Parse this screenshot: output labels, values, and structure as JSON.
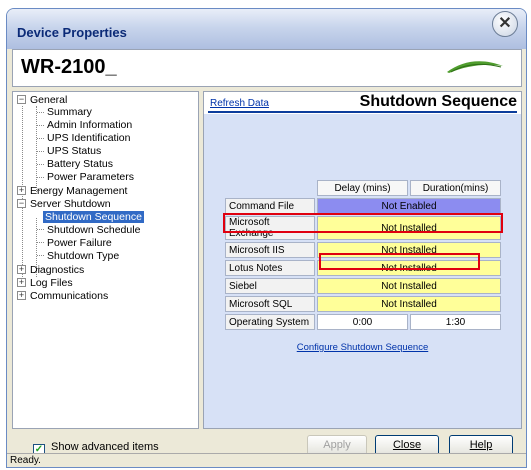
{
  "window": {
    "title": "Device Properties",
    "close_glyph": "✕"
  },
  "header": {
    "model": "WR-2100_"
  },
  "tree": {
    "general": "General",
    "summary": "Summary",
    "admin_information": "Admin Information",
    "ups_identification": "UPS Identification",
    "ups_status": "UPS Status",
    "battery_status": "Battery Status",
    "power_parameters": "Power Parameters",
    "energy_management": "Energy Management",
    "server_shutdown": "Server Shutdown",
    "shutdown_sequence": "Shutdown Sequence",
    "shutdown_schedule": "Shutdown Schedule",
    "power_failure": "Power Failure",
    "shutdown_type": "Shutdown Type",
    "diagnostics": "Diagnostics",
    "log_files": "Log Files",
    "communications": "Communications"
  },
  "main": {
    "refresh_label": "Refresh Data",
    "section_title": "Shutdown Sequence",
    "configure_link": "Configure Shutdown Sequence",
    "columns": {
      "delay": "Delay (mins)",
      "duration": "Duration(mins)"
    },
    "rows": [
      {
        "label": "Command File",
        "value": "Not Enabled"
      },
      {
        "label": "Microsoft Exchange",
        "value": "Not Installed"
      },
      {
        "label": "Microsoft IIS",
        "value": "Not Installed"
      },
      {
        "label": "Lotus Notes",
        "value": "Not Installed"
      },
      {
        "label": "Siebel",
        "value": "Not Installed"
      },
      {
        "label": "Microsoft SQL",
        "value": "Not Installed"
      },
      {
        "label": "Operating System",
        "delay": "0:00",
        "duration": "1:30"
      }
    ]
  },
  "footer": {
    "show_advanced_label": "Show advanced items",
    "show_advanced_checked": true,
    "apply_label": "Apply",
    "close_label": "Close",
    "help_label": "Help",
    "status": "Ready."
  },
  "colors": {
    "selection": "#316ac5",
    "highlight_box": "#e0000f",
    "not_enabled": "#8c8cf0",
    "not_installed": "#ffff99"
  }
}
